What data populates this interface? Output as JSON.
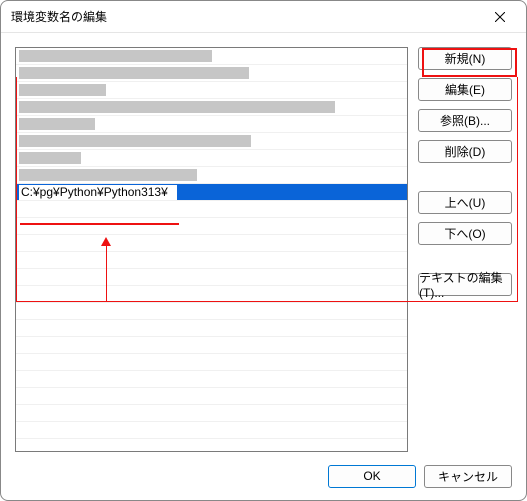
{
  "window": {
    "title": "環境変数名の編集"
  },
  "list": {
    "rows": [
      {
        "redact_width": 193
      },
      {
        "redact_width": 230
      },
      {
        "redact_width": 87
      },
      {
        "redact_width": 316
      },
      {
        "redact_width": 76
      },
      {
        "redact_width": 232
      },
      {
        "redact_width": 62
      },
      {
        "redact_width": 178
      }
    ],
    "edit_value": "C:¥pg¥Python¥Python313¥",
    "edit_box_width": 158
  },
  "buttons": {
    "new": "新規(N)",
    "edit": "編集(E)",
    "browse": "参照(B)...",
    "delete": "削除(D)",
    "up": "上へ(U)",
    "down": "下へ(O)",
    "edit_text": "テキストの編集(T)..."
  },
  "footer": {
    "ok": "OK",
    "cancel": "キャンセル"
  }
}
